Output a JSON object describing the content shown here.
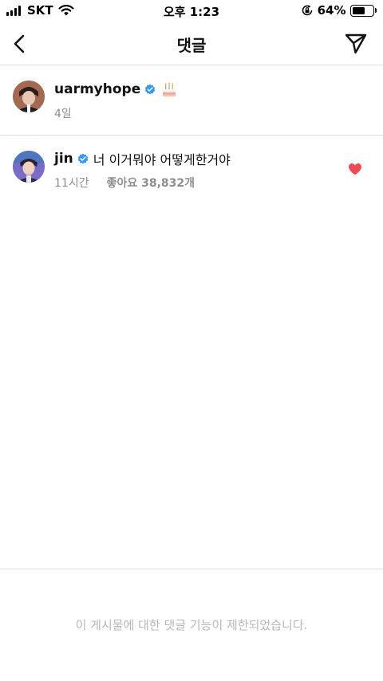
{
  "status_bar": {
    "carrier": "SKT",
    "time": "오후 1:23",
    "battery_percent": "64%",
    "battery_level": 0.64,
    "icons": [
      "signal-icon",
      "wifi-icon",
      "orientation-lock-icon",
      "battery-icon"
    ]
  },
  "header": {
    "title": "댓글",
    "back_icon": "chevron-left-icon",
    "send_icon": "send-icon"
  },
  "caption": {
    "username": "uarmyhope",
    "verified": true,
    "emoji_icon": "birthday-cake-icon",
    "time": "4일"
  },
  "comments": [
    {
      "username": "jin",
      "verified": true,
      "text": "너 이거뭐야 어떻게한거야",
      "time": "11시간",
      "likes": "좋아요 38,832개",
      "liked": true,
      "like_color": "#ed4956"
    }
  ],
  "footer": {
    "note": "이 게시물에 대한 댓글 기능이 제한되었습니다."
  },
  "colors": {
    "verified": "#3897f0",
    "divider": "#dbdbdb",
    "muted_text": "#8e8e8e"
  }
}
